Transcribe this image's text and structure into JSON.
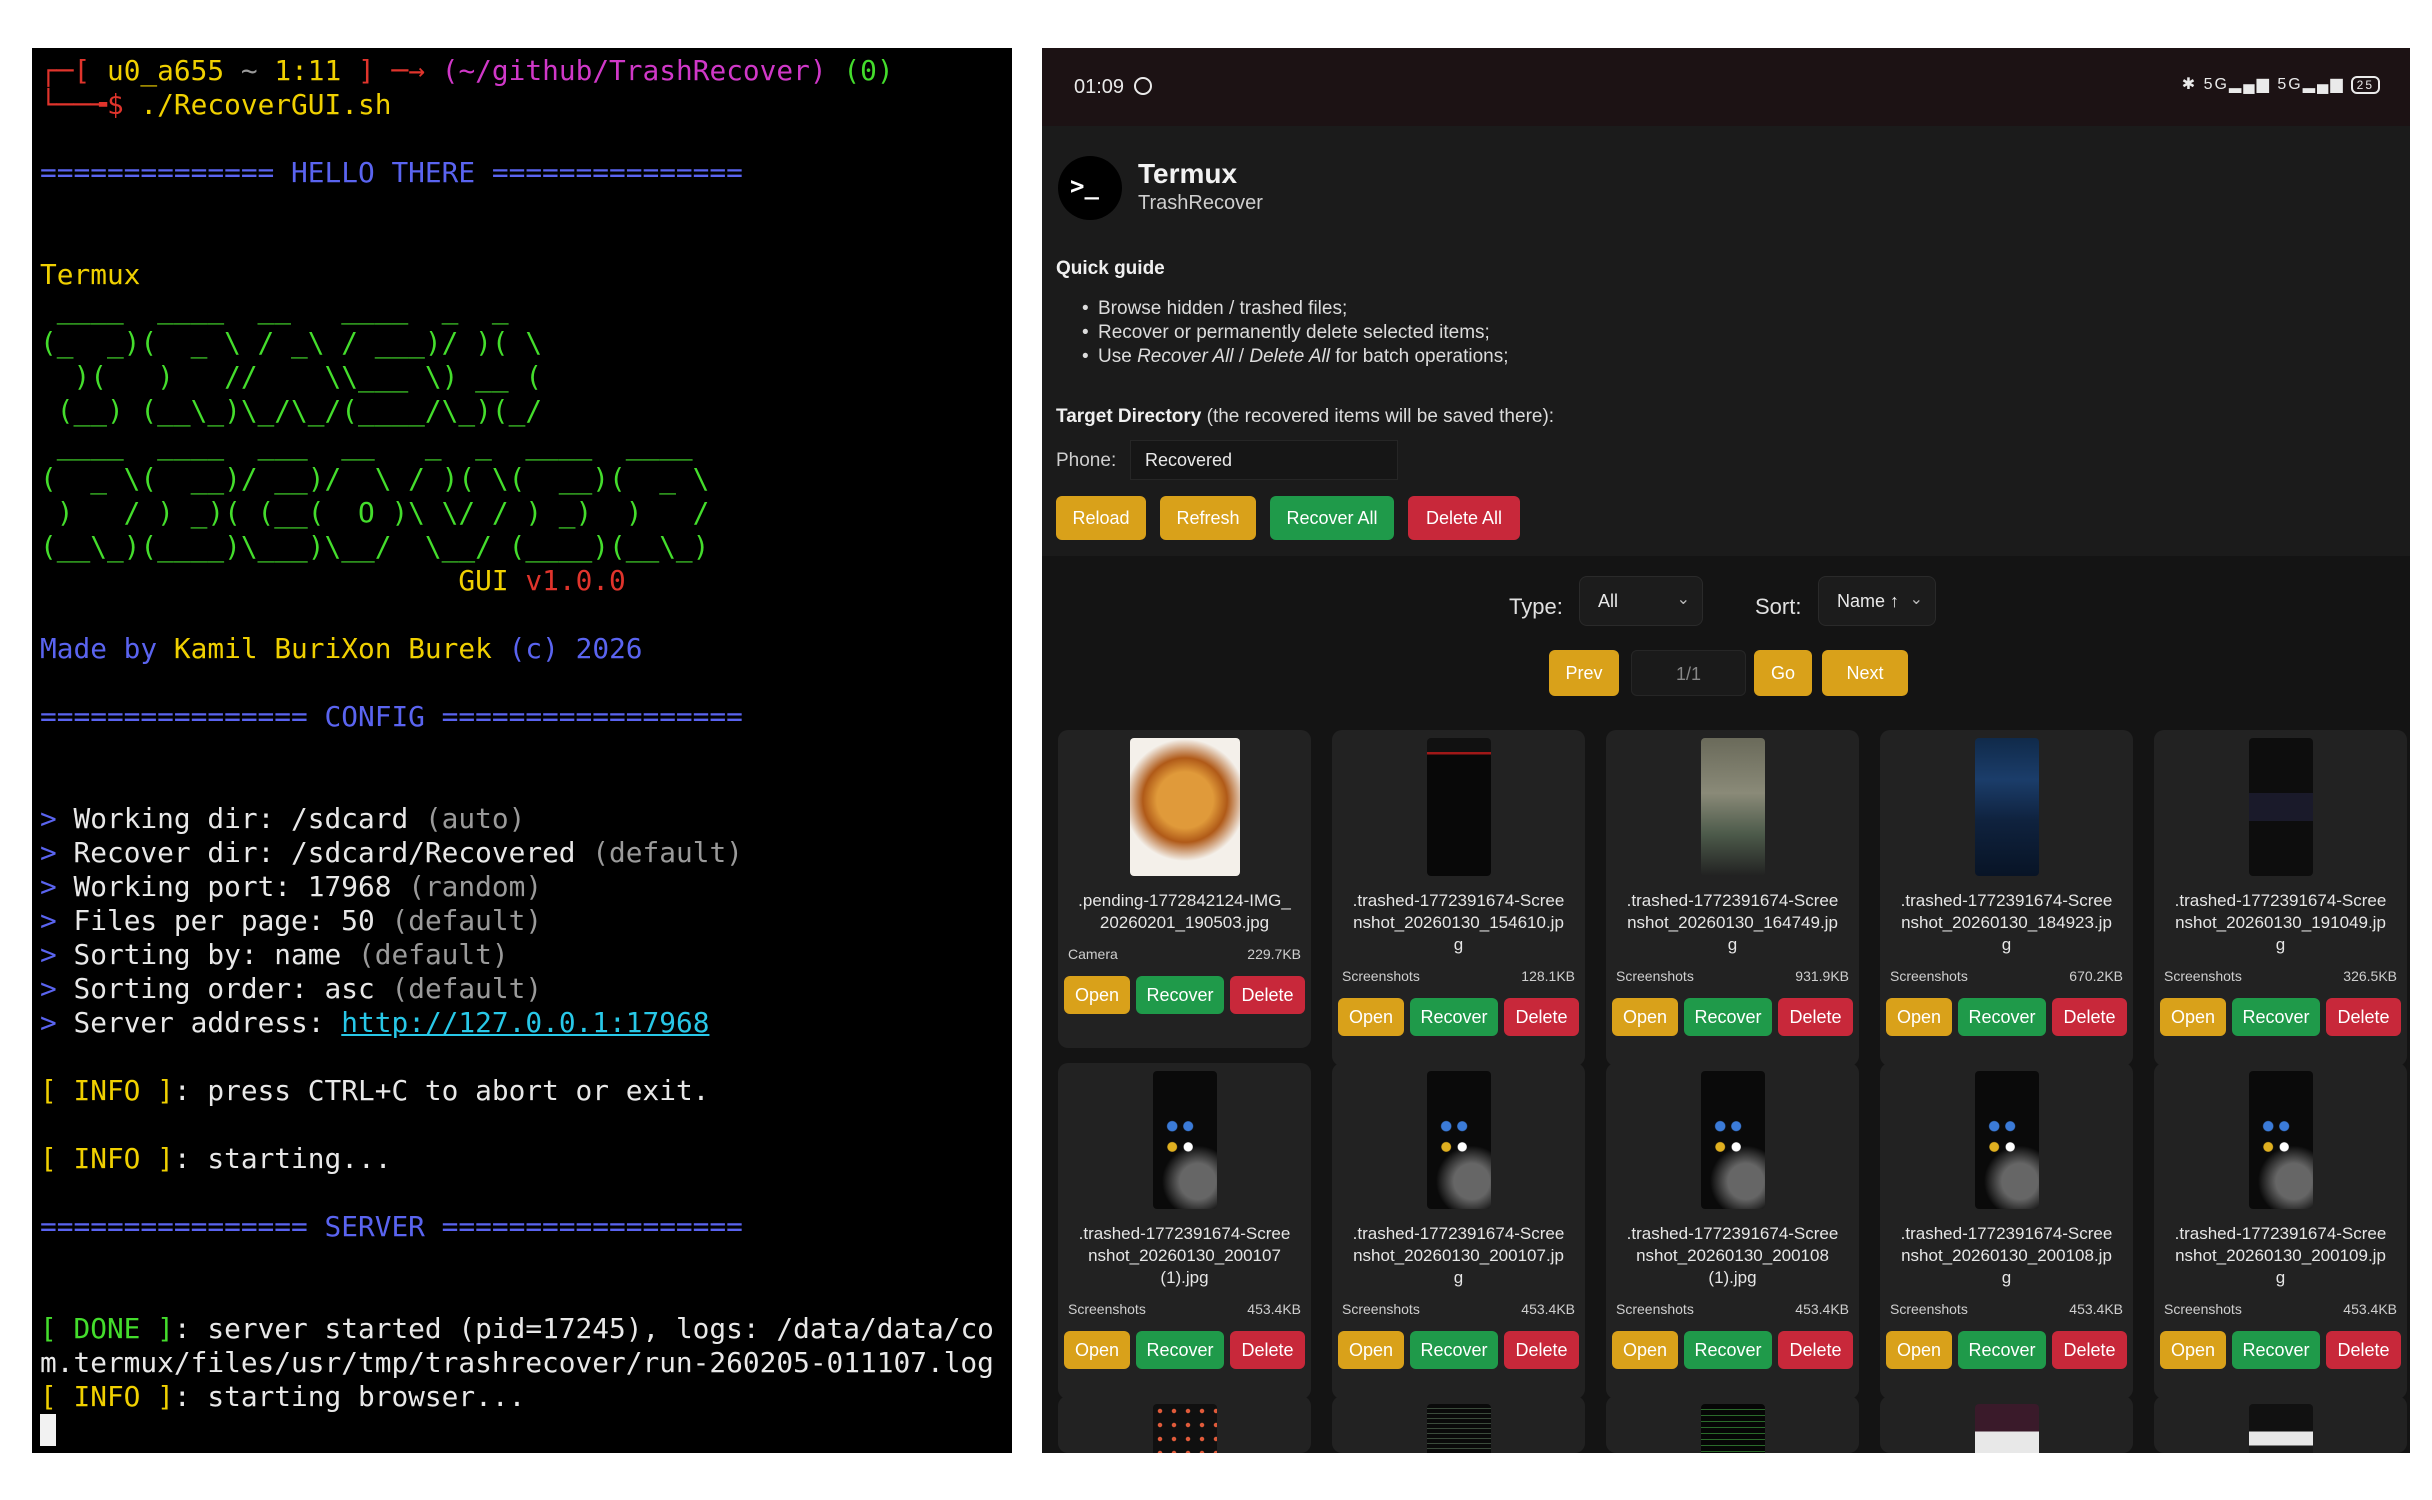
{
  "terminal": {
    "prompt_user": "u0_a655",
    "prompt_time": "1:11",
    "prompt_path": "(~/github/TrashRecover)",
    "prompt_status": "(0)",
    "command": "./RecoverGUI.sh",
    "hello_banner": "============== HELLO THERE ===============",
    "termux": "Termux",
    "ascii_art": [
      " ____  ____  __   ____  _  _ ",
      "(_  _)(  _ \\ / _\\ / ___)/ )( \\",
      "  )(   )   //    \\\\___ \\) __ (",
      " (__) (__\\_)\\_/\\_/(____/\\_)(_/",
      " ____  ____  ___  __   _  _  ____  ____ ",
      "(  _ \\(  __)/ __)/  \\ / )( \\(  __)(  _ \\",
      " )   / ) _)( (__(  O )\\ \\/ / ) _)  )   /",
      "(__\\_)(____)\\___)\\__/  \\__/ (____)(__\\_)"
    ],
    "gui_label": "GUI",
    "version": "v1.0.0",
    "made_by_prefix": "Made by",
    "author": "Kamil BuriXon Burek",
    "copyright": "(c)",
    "year": "2026",
    "config_banner": "================ CONFIG ==================",
    "config": [
      {
        "key": "Working dir: /sdcard",
        "note": "(auto)"
      },
      {
        "key": "Recover dir: /sdcard/Recovered",
        "note": "(default)"
      },
      {
        "key": "Working port: 17968",
        "note": "(random)"
      },
      {
        "key": "Files per page: 50",
        "note": "(default)"
      },
      {
        "key": "Sorting by: name",
        "note": "(default)"
      },
      {
        "key": "Sorting order: asc",
        "note": "(default)"
      }
    ],
    "server_address_label": "Server address:",
    "server_address": "http://127.0.0.1:17968",
    "info_tag": "[ INFO ]",
    "done_tag": "[ DONE ]",
    "info_abort": ": press CTRL+C to abort or exit.",
    "info_starting": ": starting...",
    "server_banner": "================ SERVER ==================",
    "done_line1": ": server started (pid=17245), logs: /data/data/co",
    "done_line2": "m.termux/files/usr/tmp/trashrecover/run-260205-011107.log",
    "info_browser": ": starting browser..."
  },
  "phone": {
    "status": {
      "time": "01:09",
      "icons": "✱ 5G▂▄▆ 5G▂▄▆",
      "battery": "25"
    },
    "app": {
      "name": "Termux",
      "subtitle": "TrashRecover",
      "logo": ">_"
    },
    "guide": {
      "title": "Quick guide",
      "items": [
        "Browse hidden / trashed files;",
        "Recover or permanently delete selected items;"
      ],
      "item3_prefix": "Use ",
      "item3_em1": "Recover All",
      "item3_sep": " / ",
      "item3_em2": "Delete All",
      "item3_suffix": " for batch operations;"
    },
    "target": {
      "label": "Target Directory",
      "note": " (the recovered items will be saved there):",
      "phone_label": "Phone:",
      "phone_value": "Recovered"
    },
    "actions": {
      "reload": "Reload",
      "refresh": "Refresh",
      "recover_all": "Recover All",
      "delete_all": "Delete All"
    },
    "filters": {
      "type_label": "Type:",
      "type_value": "All",
      "sort_label": "Sort:",
      "sort_value": "Name ↑"
    },
    "pager": {
      "prev": "Prev",
      "page": "1/1",
      "go": "Go",
      "next": "Next"
    },
    "card_buttons": {
      "open": "Open",
      "recover": "Recover",
      "delete": "Delete"
    },
    "files": [
      {
        "name": ".pending-1772842124-IMG_20260201_190503.jpg",
        "lines": [
          ".pending-1772842124-IMG_",
          "20260201_190503.jpg"
        ],
        "folder": "Camera",
        "size": "229.7KB",
        "thumb": "food"
      },
      {
        "name": ".trashed-1772391674-Screenshot_20260130_154610.jpg",
        "lines": [
          ".trashed-1772391674-Scree",
          "nshot_20260130_154610.jp",
          "g"
        ],
        "folder": "Screenshots",
        "size": "128.1KB",
        "thumb": "dark"
      },
      {
        "name": ".trashed-1772391674-Screenshot_20260130_164749.jpg",
        "lines": [
          ".trashed-1772391674-Scree",
          "nshot_20260130_164749.jp",
          "g"
        ],
        "folder": "Screenshots",
        "size": "931.9KB",
        "thumb": "map"
      },
      {
        "name": ".trashed-1772391674-Screenshot_20260130_184923.jpg",
        "lines": [
          ".trashed-1772391674-Scree",
          "nshot_20260130_184923.jp",
          "g"
        ],
        "folder": "Screenshots",
        "size": "670.2KB",
        "thumb": "blue"
      },
      {
        "name": ".trashed-1772391674-Screenshot_20260130_191049.jpg",
        "lines": [
          ".trashed-1772391674-Scree",
          "nshot_20260130_191049.jp",
          "g"
        ],
        "folder": "Screenshots",
        "size": "326.5KB",
        "thumb": "list"
      },
      {
        "name": ".trashed-1772391674-Screenshot_20260130_200107 (1).jpg",
        "lines": [
          ".trashed-1772391674-Scree",
          "nshot_20260130_200107",
          "(1).jpg"
        ],
        "folder": "Screenshots",
        "size": "453.4KB",
        "thumb": "dots"
      },
      {
        "name": ".trashed-1772391674-Screenshot_20260130_200107.jpg",
        "lines": [
          ".trashed-1772391674-Scree",
          "nshot_20260130_200107.jp",
          "g"
        ],
        "folder": "Screenshots",
        "size": "453.4KB",
        "thumb": "dots"
      },
      {
        "name": ".trashed-1772391674-Screenshot_20260130_200108 (1).jpg",
        "lines": [
          ".trashed-1772391674-Scree",
          "nshot_20260130_200108",
          "(1).jpg"
        ],
        "folder": "Screenshots",
        "size": "453.4KB",
        "thumb": "dots"
      },
      {
        "name": ".trashed-1772391674-Screenshot_20260130_200108.jpg",
        "lines": [
          ".trashed-1772391674-Scree",
          "nshot_20260130_200108.jp",
          "g"
        ],
        "folder": "Screenshots",
        "size": "453.4KB",
        "thumb": "dots"
      },
      {
        "name": ".trashed-1772391674-Screenshot_20260130_200109.jpg",
        "lines": [
          ".trashed-1772391674-Scree",
          "nshot_20260130_200109.jp",
          "g"
        ],
        "folder": "Screenshots",
        "size": "453.4KB",
        "thumb": "dots"
      }
    ],
    "partial_thumbs": [
      "emoji",
      "code",
      "terminal",
      "chart",
      "list"
    ]
  }
}
